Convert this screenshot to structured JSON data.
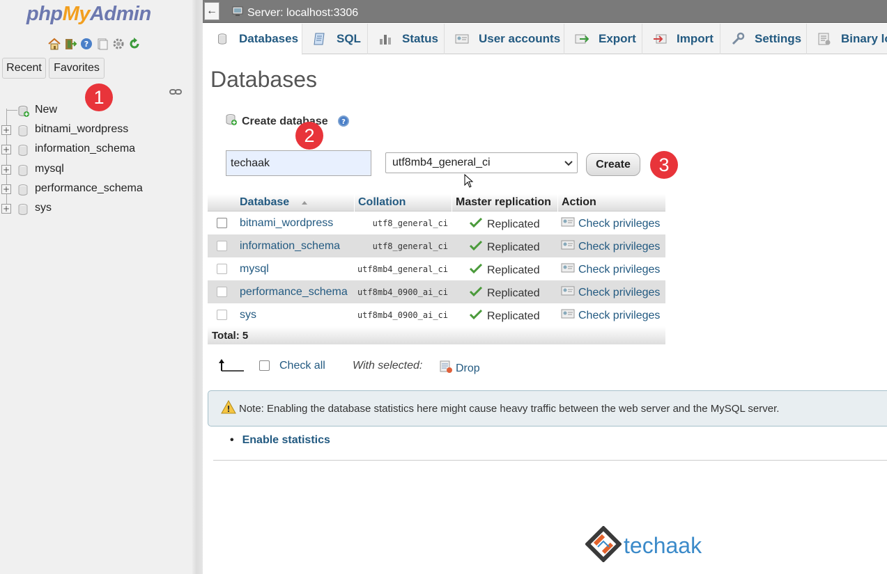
{
  "app": {
    "logo": {
      "php": "php",
      "my": "My",
      "admin": "Admin"
    },
    "colors": {
      "link": "#235a81",
      "accent": "#f29f1f",
      "logo_blue": "#6c78af",
      "badge": "#e8343a"
    }
  },
  "sidebar": {
    "nav_icons": [
      "home-icon",
      "exit-icon",
      "help-icon",
      "docs-icon",
      "gear-icon",
      "reload-icon"
    ],
    "recent_label": "Recent",
    "favorites_label": "Favorites",
    "tree": [
      {
        "label": "New",
        "icon": "new-database-icon"
      },
      {
        "label": "bitnami_wordpress",
        "icon": "database-icon"
      },
      {
        "label": "information_schema",
        "icon": "database-icon"
      },
      {
        "label": "mysql",
        "icon": "database-icon"
      },
      {
        "label": "performance_schema",
        "icon": "database-icon"
      },
      {
        "label": "sys",
        "icon": "database-icon"
      }
    ]
  },
  "topbar": {
    "collapse_glyph": "←",
    "server_label": "Server: localhost:3306"
  },
  "tabs": [
    {
      "label": "Databases",
      "icon": "database-icon",
      "active": true
    },
    {
      "label": "SQL",
      "icon": "sql-icon"
    },
    {
      "label": "Status",
      "icon": "status-icon"
    },
    {
      "label": "User accounts",
      "icon": "users-icon"
    },
    {
      "label": "Export",
      "icon": "export-icon"
    },
    {
      "label": "Import",
      "icon": "import-icon"
    },
    {
      "label": "Settings",
      "icon": "wrench-icon"
    },
    {
      "label": "Binary lo",
      "icon": "binary-log-icon"
    }
  ],
  "main": {
    "title": "Databases",
    "create": {
      "heading": "Create database",
      "db_name_value": "techaak",
      "collation_value": "utf8mb4_general_ci",
      "create_label": "Create"
    },
    "badges": [
      "1",
      "2",
      "3"
    ],
    "table": {
      "headers": {
        "database": "Database",
        "collation": "Collation",
        "replication": "Master replication",
        "action": "Action"
      },
      "rows": [
        {
          "database": "bitnami_wordpress",
          "collation": "utf8_general_ci",
          "replication": "Replicated",
          "action": "Check privileges"
        },
        {
          "database": "information_schema",
          "collation": "utf8_general_ci",
          "replication": "Replicated",
          "action": "Check privileges"
        },
        {
          "database": "mysql",
          "collation": "utf8mb4_general_ci",
          "replication": "Replicated",
          "action": "Check privileges"
        },
        {
          "database": "performance_schema",
          "collation": "utf8mb4_0900_ai_ci",
          "replication": "Replicated",
          "action": "Check privileges"
        },
        {
          "database": "sys",
          "collation": "utf8mb4_0900_ai_ci",
          "replication": "Replicated",
          "action": "Check privileges"
        }
      ],
      "total": "Total: 5"
    },
    "bulk": {
      "check_all": "Check all",
      "with_selected": "With selected:",
      "drop": "Drop"
    },
    "note": "Note: Enabling the database statistics here might cause heavy traffic between the web server and the MySQL server.",
    "enable_stats": "Enable statistics"
  },
  "watermark": {
    "text": "techaak"
  }
}
